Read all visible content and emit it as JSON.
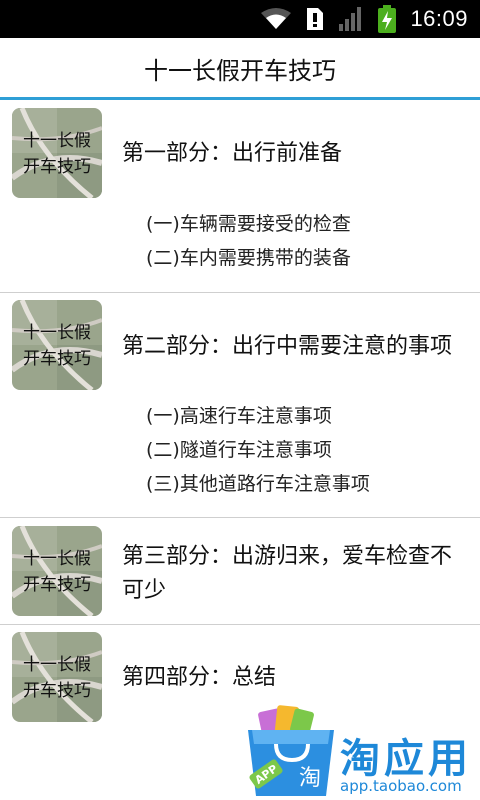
{
  "status_bar": {
    "time": "16:09",
    "icons": [
      "wifi-icon",
      "notification-icon",
      "signal-icon",
      "battery-charging-icon"
    ]
  },
  "header": {
    "title": "十一长假开车技巧"
  },
  "sections": [
    {
      "thumb_text": [
        "十一长假",
        "开车技巧"
      ],
      "title": "第一部分：出行前准备",
      "items": [
        "(一)车辆需要接受的检查",
        "(二)车内需要携带的装备"
      ]
    },
    {
      "thumb_text": [
        "十一长假",
        "开车技巧"
      ],
      "title": "第二部分：出行中需要注意的事项",
      "items": [
        "(一)高速行车注意事项",
        "(二)隧道行车注意事项",
        "(三)其他道路行车注意事项"
      ]
    },
    {
      "thumb_text": [
        "十一长假",
        "开车技巧"
      ],
      "title": "第三部分：出游归来，爱车检查不可少",
      "items": []
    },
    {
      "thumb_text": [
        "十一长假",
        "开车技巧"
      ],
      "title": "第四部分：总结",
      "items": []
    }
  ],
  "badge": {
    "name": "淘应用",
    "url": "app.taobao.com",
    "bag_label": "APP",
    "bag_char": "淘"
  },
  "colors": {
    "accent": "#2e9fd6",
    "badge_blue": "#1e88d8",
    "status_bar": "#000000",
    "battery_green": "#4caf1e"
  }
}
